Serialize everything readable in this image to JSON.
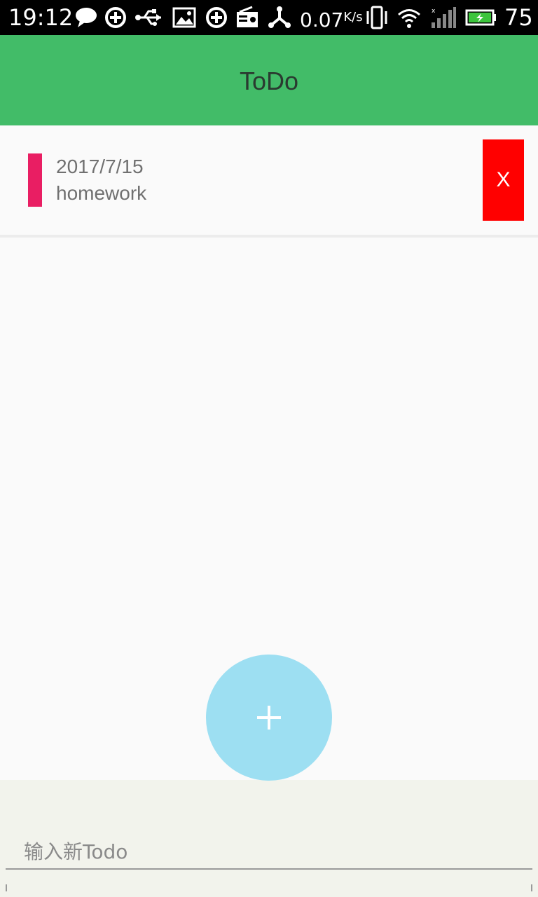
{
  "status_bar": {
    "time": "19:12",
    "speed_value": "0.07",
    "speed_unit": "K/s",
    "battery_percent": "75",
    "icons": [
      "message-icon",
      "sync-icon",
      "usb-icon",
      "image-icon",
      "sync-icon",
      "radio-icon",
      "share-icon",
      "vibrate-icon",
      "wifi-icon",
      "signal-icon",
      "battery-icon"
    ]
  },
  "app_bar": {
    "title": "ToDo"
  },
  "todos": [
    {
      "date": "2017/7/15",
      "text": "homework",
      "marker_color": "#e91e63",
      "delete_label": "X"
    }
  ],
  "input": {
    "placeholder": "输入新Todo",
    "value": ""
  },
  "fab": {
    "icon": "plus-icon",
    "color": "#9ddff2"
  },
  "colors": {
    "app_bar": "#42bc68",
    "delete": "#ff0000",
    "input_area": "#f2f3ec"
  }
}
